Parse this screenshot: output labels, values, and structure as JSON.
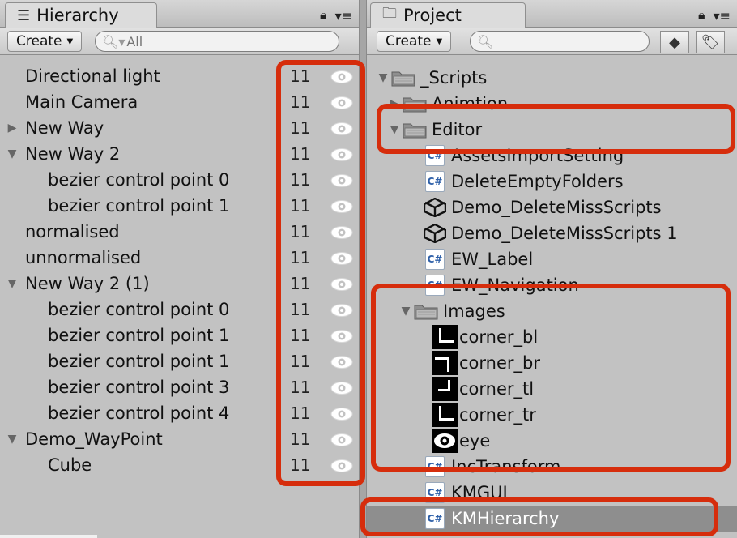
{
  "hierarchy": {
    "tab_title": "Hierarchy",
    "create_label": "Create",
    "search_placeholder": "All",
    "rows": [
      {
        "label": "Directional light",
        "count": "11",
        "indent": 0,
        "arrow": ""
      },
      {
        "label": "Main Camera",
        "count": "11",
        "indent": 0,
        "arrow": ""
      },
      {
        "label": "New Way",
        "count": "11",
        "indent": 0,
        "arrow": "▶"
      },
      {
        "label": "New Way 2",
        "count": "11",
        "indent": 0,
        "arrow": "▼"
      },
      {
        "label": "bezier control point 0",
        "count": "11",
        "indent": 1,
        "arrow": ""
      },
      {
        "label": "bezier control point 1",
        "count": "11",
        "indent": 1,
        "arrow": ""
      },
      {
        "label": "normalised",
        "count": "11",
        "indent": 0,
        "arrow": ""
      },
      {
        "label": "unnormalised",
        "count": "11",
        "indent": 0,
        "arrow": ""
      },
      {
        "label": "New Way 2 (1)",
        "count": "11",
        "indent": 0,
        "arrow": "▼"
      },
      {
        "label": "bezier control point 0",
        "count": "11",
        "indent": 1,
        "arrow": ""
      },
      {
        "label": "bezier control point 1",
        "count": "11",
        "indent": 1,
        "arrow": ""
      },
      {
        "label": "bezier control point 1",
        "count": "11",
        "indent": 1,
        "arrow": ""
      },
      {
        "label": "bezier control point 3",
        "count": "11",
        "indent": 1,
        "arrow": ""
      },
      {
        "label": "bezier control point 4",
        "count": "11",
        "indent": 1,
        "arrow": ""
      },
      {
        "label": "Demo_WayPoint",
        "count": "11",
        "indent": 0,
        "arrow": "▼"
      },
      {
        "label": "Cube",
        "count": "11",
        "indent": 1,
        "arrow": ""
      }
    ]
  },
  "project": {
    "tab_title": "Project",
    "create_label": "Create",
    "search_placeholder": "",
    "rows": [
      {
        "label": "_Scripts",
        "icon": "folder-icon",
        "arrow": "▼"
      },
      {
        "label": "Animtion",
        "icon": "folder-icon",
        "arrow": "▶"
      },
      {
        "label": "Editor",
        "icon": "folder-icon",
        "arrow": "▼"
      },
      {
        "label": "AssetsImportSetting",
        "icon": "csharp-script-icon",
        "arrow": ""
      },
      {
        "label": "DeleteEmptyFolders",
        "icon": "csharp-script-icon",
        "arrow": ""
      },
      {
        "label": "Demo_DeleteMissScripts",
        "icon": "unity-scene-icon",
        "arrow": ""
      },
      {
        "label": "Demo_DeleteMissScripts 1",
        "icon": "unity-scene-icon",
        "arrow": ""
      },
      {
        "label": "EW_Label",
        "icon": "csharp-script-icon",
        "arrow": ""
      },
      {
        "label": "EW_Navigation",
        "icon": "csharp-script-icon",
        "arrow": ""
      },
      {
        "label": "Images",
        "icon": "folder-icon",
        "arrow": "▼"
      },
      {
        "label": "corner_bl",
        "icon": "texture-icon",
        "arrow": ""
      },
      {
        "label": "corner_br",
        "icon": "texture-icon",
        "arrow": ""
      },
      {
        "label": "corner_tl",
        "icon": "texture-icon",
        "arrow": ""
      },
      {
        "label": "corner_tr",
        "icon": "texture-icon",
        "arrow": ""
      },
      {
        "label": "eye",
        "icon": "eye-texture-icon",
        "arrow": ""
      },
      {
        "label": "IncTransform",
        "icon": "csharp-script-icon",
        "arrow": ""
      },
      {
        "label": "KMGUI",
        "icon": "csharp-script-icon",
        "arrow": ""
      },
      {
        "label": "KMHierarchy",
        "icon": "csharp-script-icon",
        "arrow": ""
      }
    ]
  },
  "icons": {
    "csharp_glyph": "C#"
  },
  "colors": {
    "highlight": "#d62d0c",
    "selection": "#8e8e8e",
    "panel_bg": "#c2c2c2"
  }
}
